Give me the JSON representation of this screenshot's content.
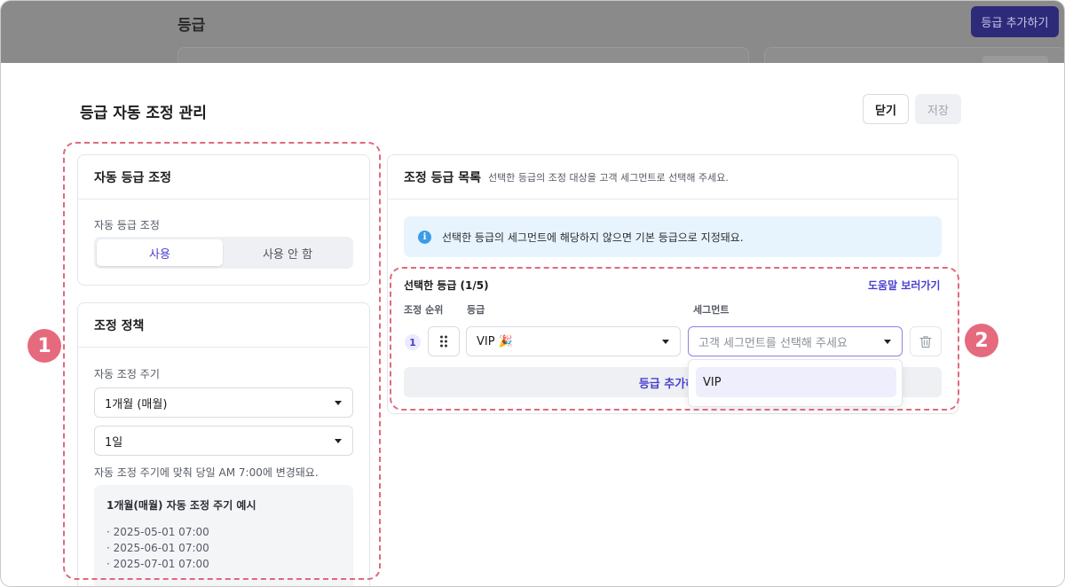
{
  "background": {
    "title": "등급",
    "add_button": "등급 추가하기"
  },
  "modal": {
    "title": "등급 자동 조정 관리",
    "close_label": "닫기",
    "save_label": "저장"
  },
  "auto_card": {
    "title": "자동 등급 조정",
    "toggle_label": "자동 등급 조정",
    "toggle_on": "사용",
    "toggle_off": "사용 안 함",
    "selected": "사용"
  },
  "policy_card": {
    "title": "조정 정책",
    "cycle_label": "자동 조정 주기",
    "cycle_value": "1개월 (매월)",
    "day_value": "1일",
    "hint": "자동 조정 주기에 맞춰 당일 AM 7:00에 변경돼요.",
    "example_title": "1개월(매월) 자동 조정 주기 예시",
    "example_items": [
      "· 2025-05-01 07:00",
      "· 2025-06-01 07:00",
      "· 2025-07-01 07:00"
    ]
  },
  "list_card": {
    "title": "조정 등급 목록",
    "subtitle": "선택한 등급의 조정 대상을 고객 세그먼트로 선택해 주세요.",
    "info_text": "선택한 등급의 세그먼트에 해당하지 않으면 기본 등급으로 지정돼요.",
    "selected_heading": "선택한 등급 (1/5)",
    "help_link": "도움말 보러가기",
    "col_rank": "조정 순위",
    "col_grade": "등급",
    "col_segment": "세그먼트",
    "row": {
      "rank": "1",
      "grade": "VIP 🎉",
      "segment_placeholder": "고객 세그먼트를 선택해 주세요"
    },
    "add_grade_label": "등급 추가하기",
    "dropdown_options": [
      "VIP"
    ]
  },
  "annotations": [
    "1",
    "2"
  ],
  "colors": {
    "accent": "#4b3fd1",
    "annotation": "#e66a7e",
    "info_bg": "#e8f4fd"
  }
}
